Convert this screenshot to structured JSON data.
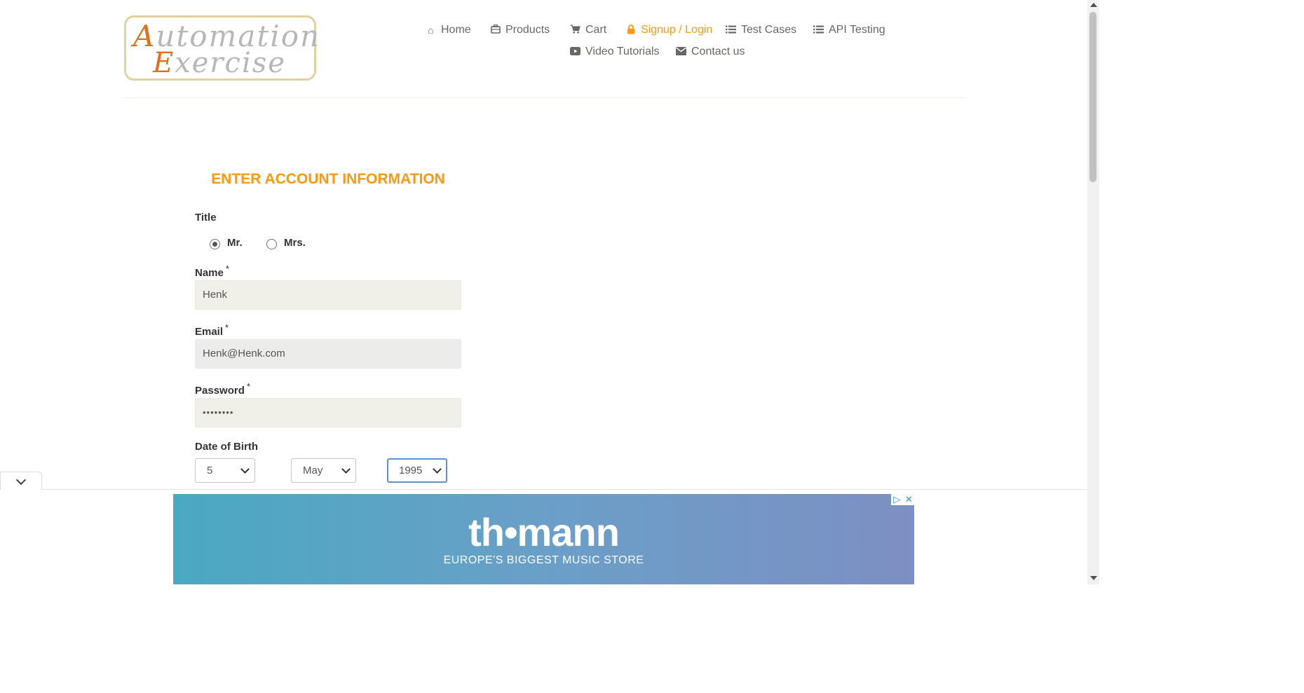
{
  "header": {
    "logo_line1_cap": "A",
    "logo_line1_rest": "utomation",
    "logo_line2_cap": "E",
    "logo_line2_rest": "xercise",
    "nav": {
      "home": "Home",
      "products": "Products",
      "cart": "Cart",
      "signup": "Signup / Login",
      "test_cases": "Test Cases",
      "api_testing": "API Testing",
      "video": "Video Tutorials",
      "contact": "Contact us"
    }
  },
  "form": {
    "heading": "ENTER ACCOUNT INFORMATION",
    "title_label": "Title",
    "title_options": [
      "Mr.",
      "Mrs."
    ],
    "title_selected": "Mr.",
    "name_label": "Name",
    "name_value": "Henk",
    "email_label": "Email",
    "email_value": "Henk@Henk.com",
    "password_label": "Password",
    "password_value": "••••••••",
    "required_mark": "*",
    "dob_label": "Date of Birth",
    "dob_day": "5",
    "dob_month": "May",
    "dob_year": "1995"
  },
  "ad": {
    "brand": "th•mann",
    "tagline": "EUROPE'S BIGGEST MUSIC STORE",
    "choices_play": "▷",
    "choices_close": "✕"
  },
  "icons": {
    "home": "home-icon",
    "products": "briefcase-icon",
    "cart": "cart-icon",
    "signup": "lock-icon",
    "test_cases": "list-icon",
    "api": "list-icon",
    "video": "youtube-play-icon",
    "contact": "envelope-icon"
  },
  "colors": {
    "accent": "#fe980f",
    "nav_text": "#696763",
    "input_bg": "#f0f0e9"
  }
}
